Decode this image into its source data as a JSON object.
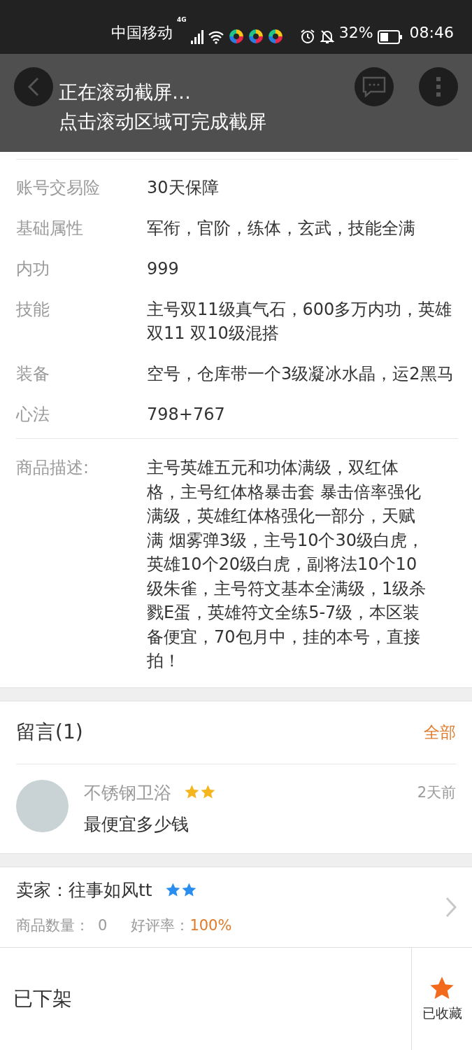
{
  "status_bar": {
    "carrier": "中国移动",
    "network": "4G",
    "battery_percent": "32%",
    "time": "08:46"
  },
  "toast": {
    "lines": [
      "正在滚动截屏…",
      "点击滚动区域可完成截屏"
    ]
  },
  "details": [
    {
      "label": "账号交易险",
      "value": "30天保障"
    },
    {
      "label": "基础属性",
      "value": "军衔，官阶，练体，玄武，技能全满"
    },
    {
      "label": "内功",
      "value": "999"
    },
    {
      "label": "技能",
      "value": "主号双11级真气石，600多万内功，英雄双11 双10级混搭"
    },
    {
      "label": "装备",
      "value": "空号，仓库带一个3级凝冰水晶，运2黑马"
    },
    {
      "label": "心法",
      "value": "798+767"
    }
  ],
  "description": {
    "label": "商品描述:",
    "value": "主号英雄五元和功体满级，双红体格，主号红体格暴击套 暴击倍率强化满级，英雄红体格强化一部分，天赋满 烟雾弹3级，主号10个30级白虎，英雄10个20级白虎，副将法10个10级朱雀，主号符文基本全满级，1级杀戮E蛋，英雄符文全练5-7级，本区装备便宜，70包月中，挂的本号，直接拍！"
  },
  "comments": {
    "title": "留言(1)",
    "all_link": "全部",
    "items": [
      {
        "user": "不锈钢卫浴",
        "time": "2天前",
        "text": "最便宜多少钱"
      }
    ]
  },
  "seller": {
    "name": "卖家：往事如风tt",
    "count_label": "商品数量：",
    "count": "0",
    "rating_label": "好评率：",
    "rating": "100%"
  },
  "bottom_bar": {
    "status": "已下架",
    "favorite": {
      "label": "已收藏",
      "selected": true
    }
  }
}
